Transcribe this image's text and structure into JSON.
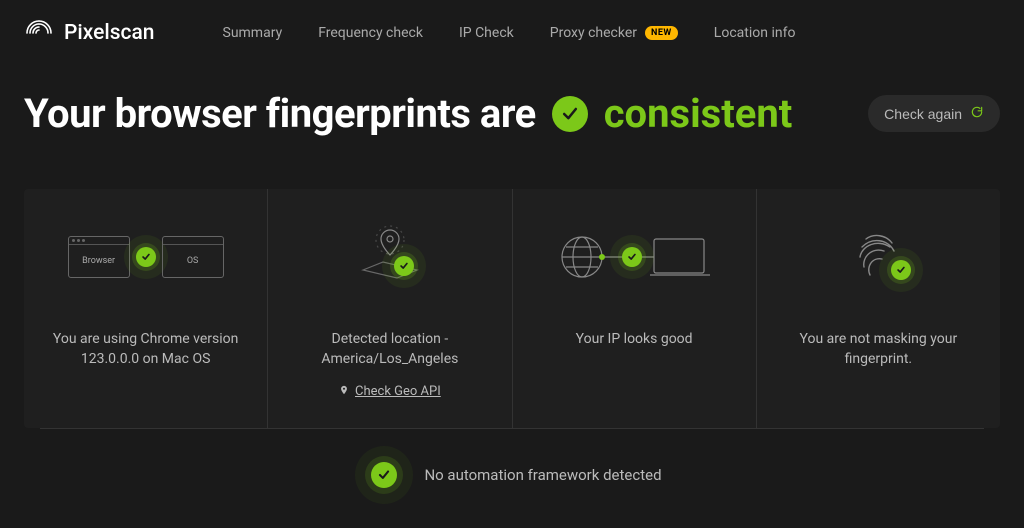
{
  "brand": "Pixelscan",
  "nav": {
    "summary": "Summary",
    "freq": "Frequency check",
    "ip": "IP Check",
    "proxy": "Proxy checker",
    "proxy_badge": "NEW",
    "location": "Location info"
  },
  "hero": {
    "prefix": "Your browser fingerprints are",
    "status": "consistent",
    "check_again": "Check again"
  },
  "cards": {
    "browser": {
      "box_browser": "Browser",
      "box_os": "OS",
      "text": "You are using Chrome version 123.0.0.0 on Mac OS"
    },
    "location": {
      "text": "Detected location - America/Los_Angeles",
      "link": "Check Geo API"
    },
    "ip": {
      "text": "Your IP looks good"
    },
    "fingerprint": {
      "text": "You are not masking your fingerprint."
    }
  },
  "footer": {
    "text": "No automation framework detected"
  },
  "colors": {
    "accent": "#7cc819",
    "badge": "#ffb700"
  }
}
